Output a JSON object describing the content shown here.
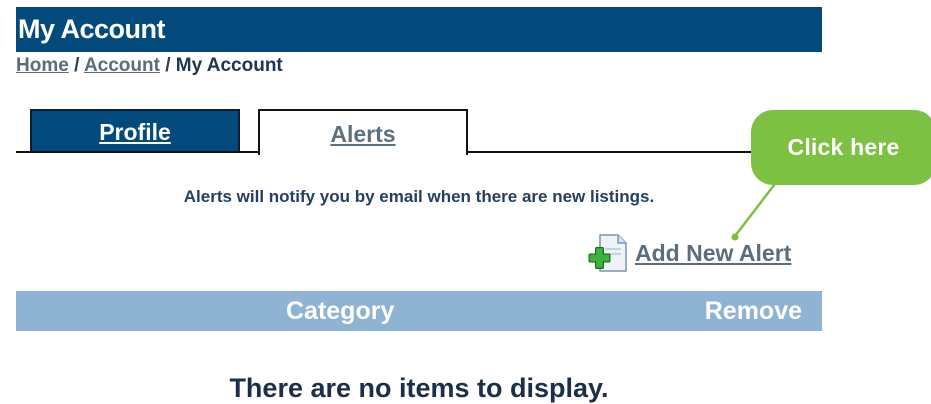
{
  "header": {
    "title": "My Account"
  },
  "breadcrumb": {
    "home": "Home",
    "separator1": " / ",
    "account": "Account",
    "separator2": " / ",
    "current": "My Account"
  },
  "tabs": [
    {
      "label": "Profile",
      "active": false
    },
    {
      "label": "Alerts",
      "active": true
    }
  ],
  "alerts": {
    "info": "Alerts will notify you by email when there are new listings.",
    "add_label": "Add New Alert",
    "add_icon": "add-document-icon"
  },
  "table": {
    "columns": [
      "Category",
      "Remove"
    ],
    "empty_message": "There are no items to display."
  },
  "callout": {
    "text": "Click here"
  },
  "colors": {
    "header_bg": "#034a7c",
    "table_header_bg": "#8fb3d2",
    "callout_bg": "#7dc142",
    "link": "#5b6d7c"
  }
}
